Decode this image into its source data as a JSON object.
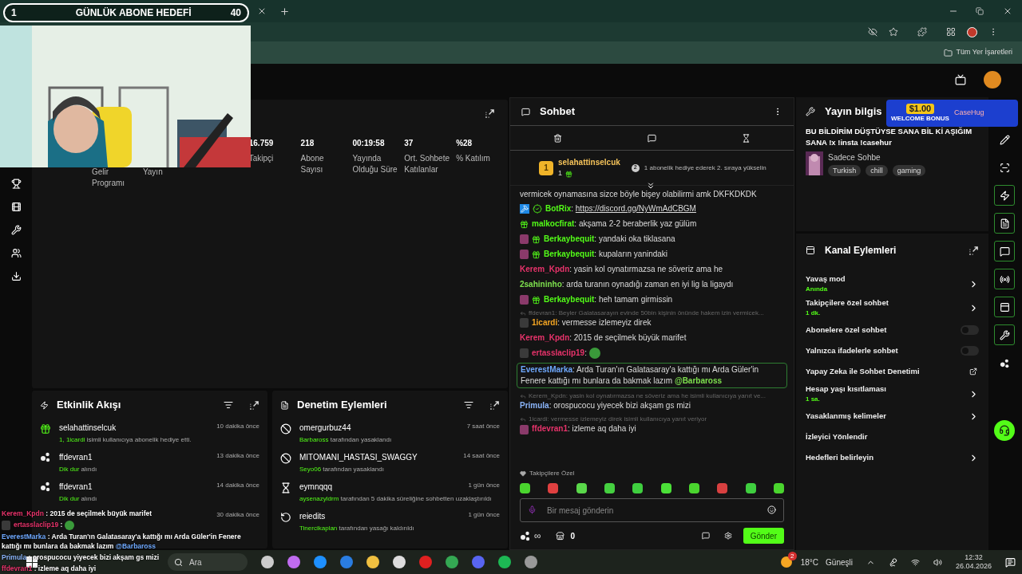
{
  "goal_bar": {
    "count": "1",
    "label": "GÜNLÜK ABONE HEDEFİ",
    "target": "40"
  },
  "browser": {
    "bookmarks": "Tüm Yer İşaretleri"
  },
  "stats": [
    {
      "label": "Gelir Programı"
    },
    {
      "label": "Yayın"
    },
    {
      "value": "16.759",
      "label": "Takipçi"
    },
    {
      "value": "218",
      "label": "Abone Sayısı"
    },
    {
      "value": "00:19:58",
      "label": "Yayında Olduğu Süre"
    },
    {
      "value": "37",
      "label": "Ort. Sohbete Katılanlar"
    },
    {
      "value": "%28",
      "label": "% Katılım"
    }
  ],
  "activity": {
    "title": "Etkinlik Akışı",
    "items": [
      {
        "kind": "gift",
        "name": "selahattinselcuk",
        "time": "10 dakika önce",
        "highlight": "1, 1icardi",
        "rest": " isimli kullanıcıya abonelik hediye etti."
      },
      {
        "kind": "points",
        "name": "ffdevran1",
        "time": "13 dakika önce",
        "highlight": "Dik dur",
        "rest": " alındı"
      },
      {
        "kind": "points",
        "name": "ffdevran1",
        "time": "14 dakika önce",
        "highlight": "Dik dur",
        "rest": " alındı"
      },
      {
        "kind": "covered",
        "time": "30 dakika önce"
      }
    ]
  },
  "moderation": {
    "title": "Denetim Eylemleri",
    "items": [
      {
        "kind": "ban",
        "name": "omergurbuz44",
        "time": "7 saat önce",
        "highlight": "Barbaross",
        "rest": " tarafından yasaklandı"
      },
      {
        "kind": "ban",
        "name": "MITOMANI_HASTASI_SWAGGY",
        "time": "14 saat önce",
        "highlight": "Seyo06",
        "rest": " tarafından yasaklandı"
      },
      {
        "kind": "timeout",
        "name": "eymnqqq",
        "time": "1 gün önce",
        "highlight": "aysenazyldrm",
        "rest": " tarafından 5 dakika süreliğine sohbetten uzaklaştırıldı"
      },
      {
        "kind": "unban",
        "name": "reiedits",
        "time": "1 gün önce",
        "highlight": "Tinercikaplan",
        "rest": " tarafından yasağı kaldırıldı"
      }
    ]
  },
  "chat": {
    "title": "Sohbet",
    "leader": {
      "rank": "1",
      "name": "selahattinselcuk",
      "count": "1",
      "next_rank": "2",
      "hint": "1 abonelik hediye ederek 2. sıraya yükselin"
    },
    "messages": [
      {
        "kind": "continuation",
        "text": "vermicek oynamasına sizce böyle bişey olabilirmi amk DKFKDKDK"
      },
      {
        "kind": "message",
        "badges": [
          {
            "kind": "mod"
          },
          {
            "kind": "verified"
          }
        ],
        "user": "BotRix",
        "color": "#53fc18",
        "text": ":",
        "link": "https://discord.gg/NyWmAdCBGM"
      },
      {
        "kind": "message",
        "badges": [
          {
            "kind": "gift"
          }
        ],
        "user": "malkocfirat",
        "color": "#53fc18",
        "text": ": akşama 2-2 beraberlik yaz gülüm"
      },
      {
        "kind": "message",
        "badges": [
          {
            "kind": "b"
          },
          {
            "kind": "gift"
          }
        ],
        "user": "Berkaybequit",
        "color": "#53fc18",
        "text": ": yandaki oka tiklasana"
      },
      {
        "kind": "message",
        "badges": [
          {
            "kind": "b"
          },
          {
            "kind": "gift"
          }
        ],
        "user": "Berkaybequit",
        "color": "#53fc18",
        "text": ": kupaların yanindaki"
      },
      {
        "kind": "message",
        "user": "Kerem_Kpdn",
        "color": "#e8336b",
        "text": ": yasin kol oynatırmazsa ne söveriz ama he"
      },
      {
        "kind": "message",
        "user": "2sahininho",
        "color": "#7ee04e",
        "text": ": arda turanın oynadığı zaman en iyi lig la ligaydı"
      },
      {
        "kind": "message",
        "badges": [
          {
            "kind": "b"
          },
          {
            "kind": "gift"
          }
        ],
        "user": "Berkaybequit",
        "color": "#53fc18",
        "text": ": heh tamam girmissin"
      },
      {
        "kind": "message",
        "reply": "ffdevran1: Beyler Galatasarayın evinde 50bin kişinin önünde hakem izin vermicek...",
        "badges": [
          {
            "kind": "bgrey"
          }
        ],
        "user": "1icardi",
        "color": "#f5a623",
        "text": ": vermesse izlemeyiz direk"
      },
      {
        "kind": "message",
        "user": "Kerem_Kpdn",
        "color": "#e8336b",
        "text": ": 2015 de seçilmek büyük marifet"
      },
      {
        "kind": "message",
        "badges": [
          {
            "kind": "bgrey"
          }
        ],
        "user": "ertasslaclip19",
        "color": "#e8336b",
        "text": ":",
        "emote": true
      },
      {
        "kind": "message",
        "highlighted": true,
        "user": "EverestMarka",
        "color": "#6ea8fe",
        "text": ": Arda Turan'ın Galatasaray'a kattığı mı Arda Güler'in Fenere kattığı mı bunlara da bakmak lazım",
        "mention": "@Barbaross"
      },
      {
        "kind": "message",
        "reply": "Kerem_Kpdn: yasin kol oynatırmazsa ne söveriz ama he isimli kullanıcıya yanıt ve...",
        "user": "Primula",
        "color": "#8ab4f8",
        "text": ": orospucocu yiyecek bizi akşam gs mizi"
      },
      {
        "kind": "message",
        "reply": "1icardi: vermesse izlemeyiz direk isimli kullanıcıya yanıt veriyor",
        "badges": [
          {
            "kind": "b"
          }
        ],
        "user": "ffdevran1",
        "color": "#e8336b",
        "text": ": izleme aq daha iyi"
      }
    ],
    "followers_label": "Takipçilere Özel",
    "placeholder": "Bir mesaj gönderin",
    "points": "∞",
    "store": "0",
    "send": "Gönder"
  },
  "stream_info": {
    "title": "Yayın bilgis",
    "headline": "BU BİLDİRİM DÜŞTÜYSE SANA BİL Kİ AŞIĞIM SANA !x !insta !casehur",
    "category": "Sadece Sohbe",
    "tags": [
      "Turkish",
      "chill",
      "gaming"
    ]
  },
  "ad_banner": {
    "amount": "$1.00",
    "caption": "WELCOME BONUS",
    "brand": "CaseHug"
  },
  "channel_actions": {
    "title": "Kanal Eylemleri",
    "items": [
      {
        "kind": "nav",
        "label": "Yavaş mod",
        "sub": "Anında"
      },
      {
        "kind": "nav",
        "label": "Takipçilere özel sohbet",
        "sub": "1 dk."
      },
      {
        "kind": "toggle",
        "label": "Abonelere özel sohbet",
        "on": false
      },
      {
        "kind": "toggle",
        "label": "Yalnızca ifadelerle sohbet",
        "on": false
      },
      {
        "kind": "external",
        "label": "Yapay Zeka ile Sohbet Denetimi"
      },
      {
        "kind": "nav",
        "label": "Hesap yaşı kısıtlaması",
        "sub": "1 sa."
      },
      {
        "kind": "nav",
        "label": "Yasaklanmış kelimeler"
      },
      {
        "kind": "plain",
        "label": "İzleyici Yönlendir"
      },
      {
        "kind": "nav",
        "label": "Hedefleri belirleyin"
      }
    ]
  },
  "side_tools": [
    {
      "kind": "pencil",
      "highlighted": false
    },
    {
      "kind": "scan",
      "highlighted": false
    },
    {
      "kind": "bolt",
      "highlighted": true
    },
    {
      "kind": "doc",
      "highlighted": true
    },
    {
      "kind": "chat",
      "highlighted": true
    },
    {
      "kind": "broadcast",
      "highlighted": true
    },
    {
      "kind": "layout",
      "highlighted": true
    },
    {
      "kind": "wrench",
      "highlighted": true
    },
    {
      "kind": "dots",
      "highlighted": false
    }
  ],
  "overlay_chat": [
    {
      "user": "Kerem_Kpdn",
      "color": "#e8336b",
      "text": ": 2015 de seçilmek büyük marifet"
    },
    {
      "user": "ertasslaclip19",
      "color": "#e8336b",
      "text": ":",
      "badges": [
        {
          "kind": "bgrey"
        }
      ],
      "emote": true
    },
    {
      "user": "EverestMarka",
      "color": "#6ea8fe",
      "text": ": Arda Turan'ın Galatasaray'a kattığı mı Arda Güler'in Fenere kattığı mı bunlara da bakmak lazım",
      "mention": "@Barbaross"
    },
    {
      "user": "Primula",
      "color": "#8ab4f8",
      "text": ": orospucocu yiyecek bizi akşam gs mizi"
    },
    {
      "user": "ffdevran1",
      "color": "#e8336b",
      "text": ": izleme aq daha iyi"
    }
  ],
  "taskbar": {
    "search": "Ara",
    "weather": "18°C",
    "condition": "Güneşli",
    "time": "12:32",
    "date": "26.04.2026",
    "weather_badge": "2"
  }
}
